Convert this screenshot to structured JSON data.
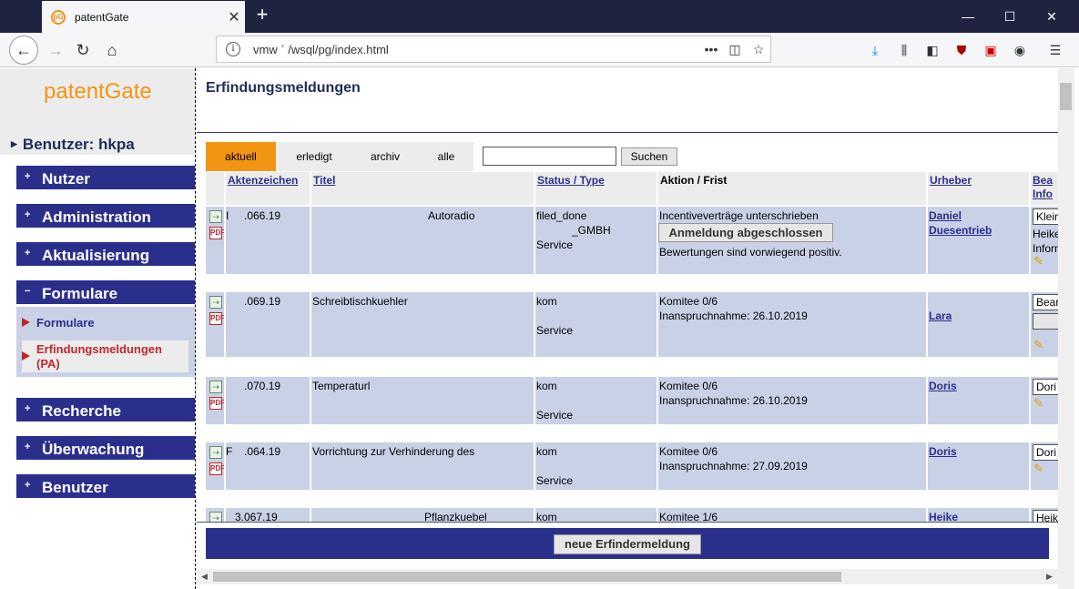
{
  "browser": {
    "tab_title": "patentGate",
    "tab_close": "✕",
    "new_tab": "+",
    "url": "vmw    ` /wsql/pg/index.html",
    "url_more": "•••"
  },
  "sidebar": {
    "logo": "patentGate",
    "user": "Benutzer: hkpa",
    "menu": [
      {
        "label": "Nutzer",
        "sign": "+"
      },
      {
        "label": "Administration",
        "sign": "+"
      },
      {
        "label": "Aktualisierung",
        "sign": "+"
      },
      {
        "label": "Formulare",
        "sign": "−"
      },
      {
        "label": "Recherche",
        "sign": "+"
      },
      {
        "label": "Überwachung",
        "sign": "+"
      },
      {
        "label": "Benutzer",
        "sign": "+"
      }
    ],
    "submenu": [
      {
        "label": "Formulare"
      },
      {
        "label": "Erfindungsmeldungen (PA)"
      }
    ]
  },
  "main": {
    "title": "Erfindungsmeldungen",
    "filters": [
      "aktuell",
      "erledigt",
      "archiv",
      "alle"
    ],
    "active_filter": "aktuell",
    "search_value": "",
    "search_button": "Suchen",
    "columns": [
      "Aktenzeichen",
      "Titel",
      "Status / Type",
      "Aktion / Frist",
      "Urheber",
      "Bea Info"
    ],
    "rows": [
      {
        "az_prefix": "I",
        "az": ".066.19",
        "titel": "Autoradio",
        "status": [
          "filed_done",
          "_GMBH",
          "Service"
        ],
        "aktion": [
          "Incentiveverträge unterschrieben",
          "Bewertungen sind vorwiegend positiv."
        ],
        "aktion_button": "Anmeldung abgeschlossen",
        "urheber": [
          "Daniel",
          "Duesentrieb"
        ],
        "bea": [
          "Klein",
          "Heike",
          "Inform"
        ]
      },
      {
        "az_prefix": "",
        "az": ".069.19",
        "titel": "Schreibtischkuehler",
        "status": [
          "kom",
          "",
          "Service"
        ],
        "aktion": [
          "Komitee 0/6",
          "Inanspruchnahme: 26.10.2019"
        ],
        "urheber": [
          "Lara"
        ],
        "bea": [
          "Bear"
        ]
      },
      {
        "az_prefix": "",
        "az": ".070.19",
        "titel": "Temperaturl",
        "status": [
          "kom",
          "",
          "Service"
        ],
        "aktion": [
          "Komitee 0/6",
          "Inanspruchnahme: 26.10.2019"
        ],
        "urheber": [
          "Doris"
        ],
        "bea": [
          "Dori"
        ]
      },
      {
        "az_prefix": "F",
        "az": ".064.19",
        "titel": "Vorrichtung zur Verhinderung des",
        "status": [
          "kom",
          "",
          "Service"
        ],
        "aktion": [
          "Komitee 0/6",
          "Inanspruchnahme: 27.09.2019"
        ],
        "urheber": [
          "Doris"
        ],
        "bea": [
          "Dori"
        ]
      },
      {
        "az_prefix": "",
        "az": "3.067.19",
        "titel": "Pflanzkuebel",
        "status": [
          "kom"
        ],
        "aktion": [
          "Komitee 1/6"
        ],
        "urheber": [
          "Heike"
        ],
        "bea": [
          "Heik"
        ]
      }
    ],
    "new_button": "neue Erfindermeldung"
  }
}
